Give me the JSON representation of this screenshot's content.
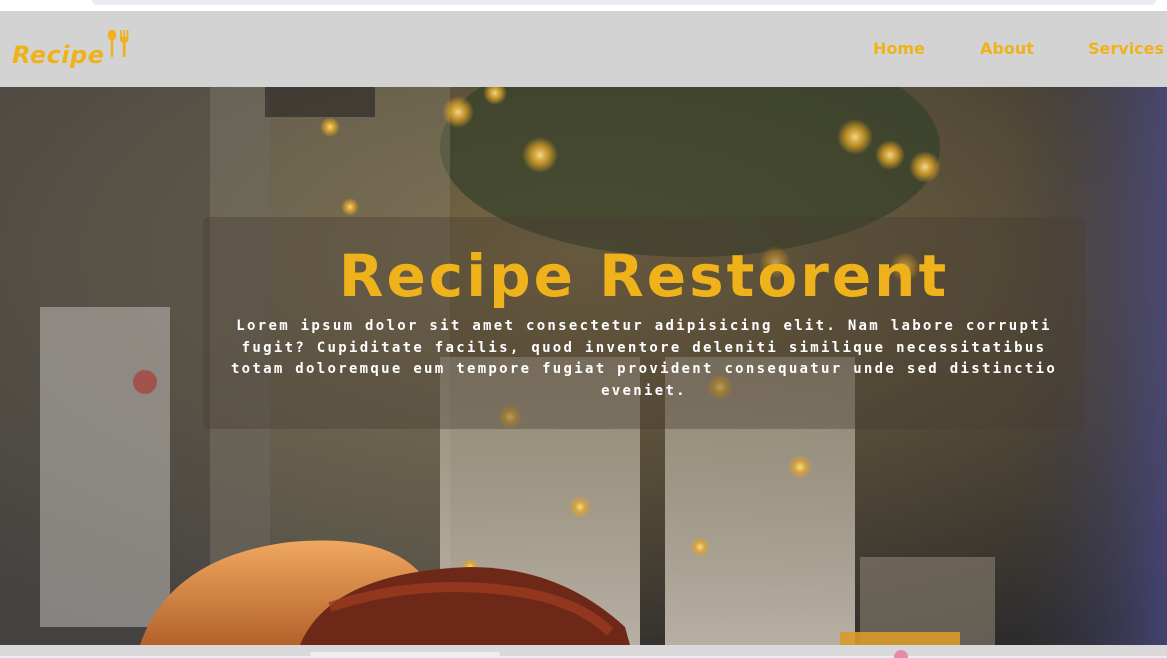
{
  "brand": {
    "name": "Recipe",
    "color": "#f0b21a",
    "icons": [
      "spoon-icon",
      "fork-icon"
    ]
  },
  "nav": {
    "items": [
      {
        "label": "Home"
      },
      {
        "label": "About"
      },
      {
        "label": "Services"
      }
    ]
  },
  "hero": {
    "title": "Recipe Restorent",
    "description": "Lorem ipsum dolor sit amet consectetur adipisicing elit. Nam labore corrupti fugit? Cupiditate facilis, quod inventore deleniti similique necessitatibus totam doloremque eum tempore fugiat provident consequatur unde sed distinctio eveniet.",
    "background": "food-photo-burger-and-glasses"
  },
  "colors": {
    "navbar_bg": "#d3d3d3",
    "accent": "#f0b21a",
    "text_light": "#ffffff"
  }
}
